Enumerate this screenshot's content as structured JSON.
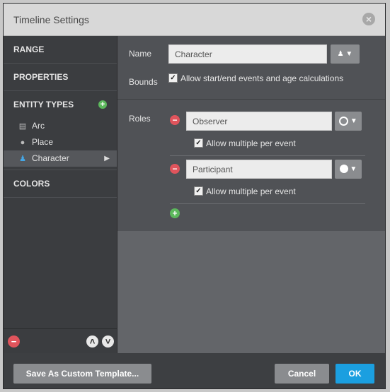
{
  "window": {
    "title": "Timeline Settings"
  },
  "sidebar": {
    "sections": {
      "range": "RANGE",
      "properties": "PROPERTIES",
      "entity_types": "ENTITY TYPES",
      "colors": "COLORS"
    },
    "entity_items": [
      {
        "label": "Arc",
        "icon": "book-icon"
      },
      {
        "label": "Place",
        "icon": "globe-icon"
      },
      {
        "label": "Character",
        "icon": "person-icon",
        "selected": true
      }
    ]
  },
  "form": {
    "name_label": "Name",
    "name_value": "Character",
    "bounds_label": "Bounds",
    "bounds_checkbox_label": "Allow start/end events and age calculations",
    "bounds_checked": true,
    "roles_label": "Roles",
    "roles": [
      {
        "name": "Observer",
        "marker": "hollow-circle",
        "allow_multiple_label": "Allow multiple per event",
        "allow_multiple": true
      },
      {
        "name": "Participant",
        "marker": "filled-circle",
        "allow_multiple_label": "Allow multiple per event",
        "allow_multiple": true
      }
    ]
  },
  "footer": {
    "save_template": "Save As Custom Template...",
    "cancel": "Cancel",
    "ok": "OK"
  },
  "colors": {
    "accent": "#1b9fe0",
    "remove": "#e0545c",
    "add": "#5cb85c",
    "selected_icon": "#45a7e6"
  }
}
